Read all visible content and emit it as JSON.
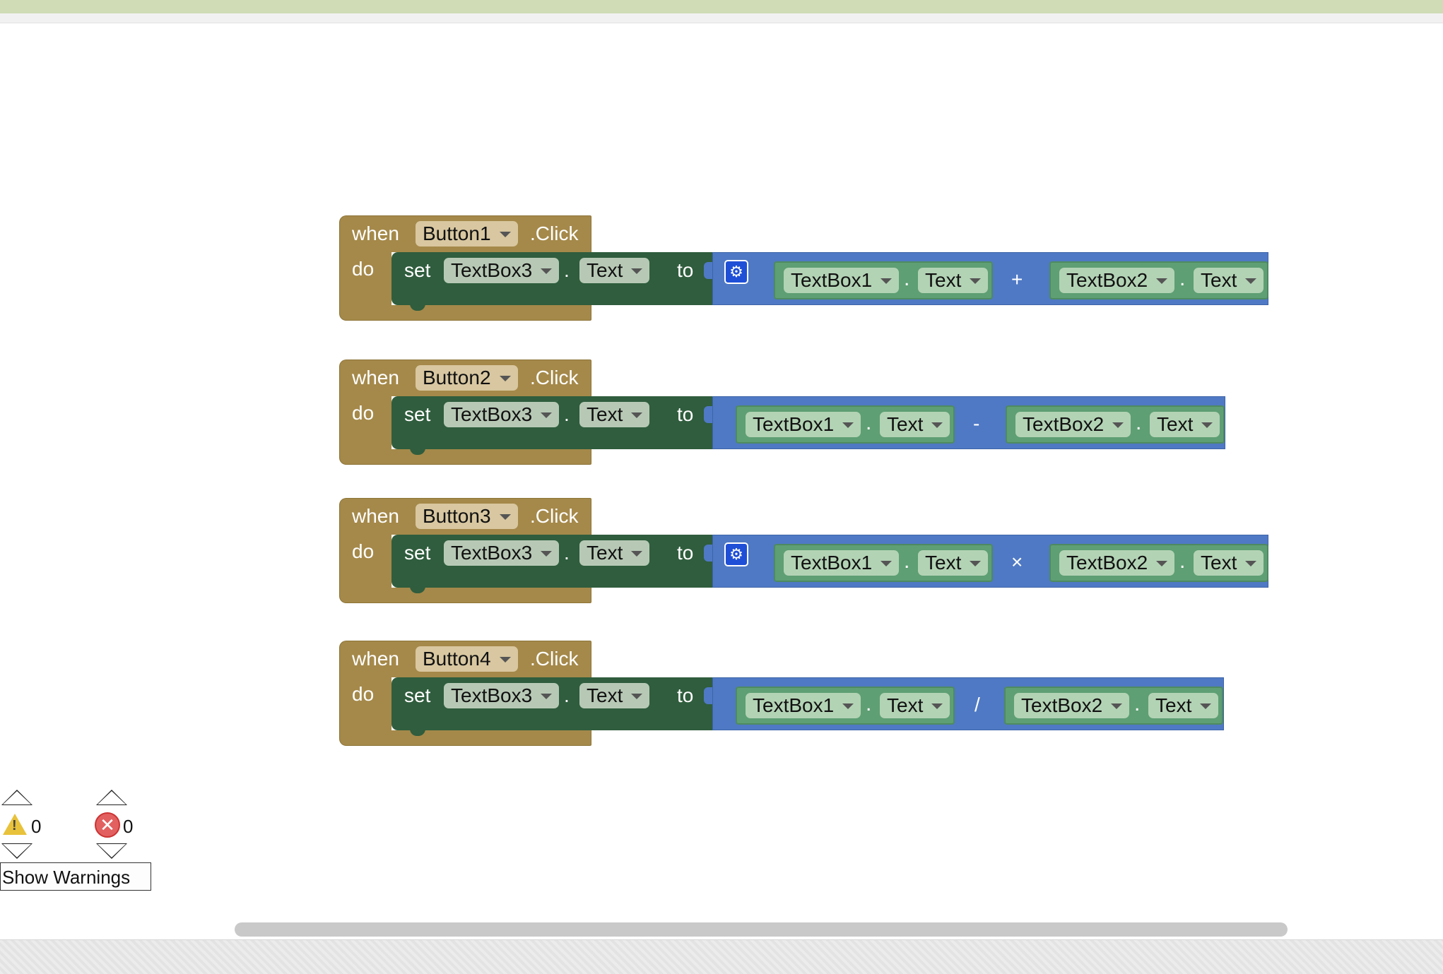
{
  "colors": {
    "event_block": "#a5894a",
    "set_block": "#2f5d3d",
    "operator_block": "#4f79c4",
    "component_block": "#5e9f73"
  },
  "labels": {
    "when": "when",
    "do": "do",
    "set": "set",
    "dot": ".",
    "to": "to",
    "click": ".Click"
  },
  "blocks": [
    {
      "button": "Button1",
      "target": "TextBox3",
      "property": "Text",
      "operator": "+",
      "has_gear": true,
      "left_comp": "TextBox1",
      "left_prop": "Text",
      "right_comp": "TextBox2",
      "right_prop": "Text"
    },
    {
      "button": "Button2",
      "target": "TextBox3",
      "property": "Text",
      "operator": "-",
      "has_gear": false,
      "left_comp": "TextBox1",
      "left_prop": "Text",
      "right_comp": "TextBox2",
      "right_prop": "Text"
    },
    {
      "button": "Button3",
      "target": "TextBox3",
      "property": "Text",
      "operator": "×",
      "has_gear": true,
      "left_comp": "TextBox1",
      "left_prop": "Text",
      "right_comp": "TextBox2",
      "right_prop": "Text"
    },
    {
      "button": "Button4",
      "target": "TextBox3",
      "property": "Text",
      "operator": "/",
      "has_gear": false,
      "left_comp": "TextBox1",
      "left_prop": "Text",
      "right_comp": "TextBox2",
      "right_prop": "Text"
    }
  ],
  "warnings": {
    "warning_count": "0",
    "error_count": "0",
    "show_warnings_label": "Show Warnings"
  }
}
